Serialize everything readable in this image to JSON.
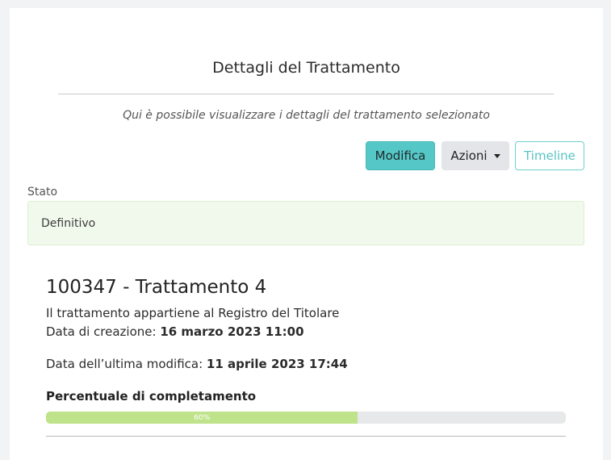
{
  "header": {
    "title": "Dettagli del Trattamento",
    "subtitle": "Qui è possibile visualizzare i dettagli del trattamento selezionato"
  },
  "toolbar": {
    "edit_label": "Modifica",
    "actions_label": "Azioni",
    "timeline_label": "Timeline"
  },
  "state": {
    "label": "Stato",
    "value": "Definitivo"
  },
  "record": {
    "title": "100347 - Trattamento 4",
    "registry_text": "Il trattamento appartiene al Registro del Titolare",
    "created_label": "Data di creazione: ",
    "created_value": "16 marzo 2023 11:00",
    "modified_label": "Data dell’ultima modifica: ",
    "modified_value": "11 aprile 2023 17:44"
  },
  "progress": {
    "label": "Percentuale di completamento",
    "text": "60%",
    "value": 60
  },
  "colors": {
    "primary": "#56c7c7",
    "success_bg": "#f1f9ec",
    "progress_fill": "#bfe38a"
  }
}
